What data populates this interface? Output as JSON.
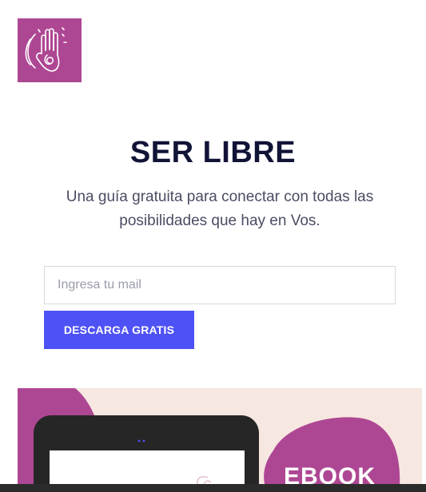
{
  "logo": {
    "icon": "hand-icon",
    "brand_color": "#ae4793"
  },
  "hero": {
    "title": "SER LIBRE",
    "subtitle": "Una guía gratuita para conectar con todas las posibilidades que hay en Vos."
  },
  "form": {
    "email_placeholder": "Ingresa tu mail",
    "email_value": "",
    "submit_label": "DESCARGA GRATIS",
    "accent_color": "#4e52f4"
  },
  "banner": {
    "label": "EBOOK",
    "background_color": "#f6e7e0",
    "blob_color": "#ae4793"
  }
}
